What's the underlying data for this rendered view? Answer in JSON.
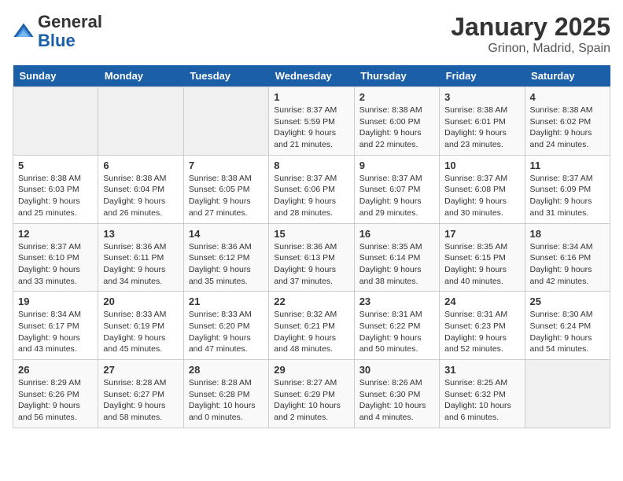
{
  "header": {
    "logo_line1": "General",
    "logo_line2": "Blue",
    "title": "January 2025",
    "subtitle": "Grinon, Madrid, Spain"
  },
  "weekdays": [
    "Sunday",
    "Monday",
    "Tuesday",
    "Wednesday",
    "Thursday",
    "Friday",
    "Saturday"
  ],
  "weeks": [
    [
      {
        "day": "",
        "info": ""
      },
      {
        "day": "",
        "info": ""
      },
      {
        "day": "",
        "info": ""
      },
      {
        "day": "1",
        "info": "Sunrise: 8:37 AM\nSunset: 5:59 PM\nDaylight: 9 hours\nand 21 minutes."
      },
      {
        "day": "2",
        "info": "Sunrise: 8:38 AM\nSunset: 6:00 PM\nDaylight: 9 hours\nand 22 minutes."
      },
      {
        "day": "3",
        "info": "Sunrise: 8:38 AM\nSunset: 6:01 PM\nDaylight: 9 hours\nand 23 minutes."
      },
      {
        "day": "4",
        "info": "Sunrise: 8:38 AM\nSunset: 6:02 PM\nDaylight: 9 hours\nand 24 minutes."
      }
    ],
    [
      {
        "day": "5",
        "info": "Sunrise: 8:38 AM\nSunset: 6:03 PM\nDaylight: 9 hours\nand 25 minutes."
      },
      {
        "day": "6",
        "info": "Sunrise: 8:38 AM\nSunset: 6:04 PM\nDaylight: 9 hours\nand 26 minutes."
      },
      {
        "day": "7",
        "info": "Sunrise: 8:38 AM\nSunset: 6:05 PM\nDaylight: 9 hours\nand 27 minutes."
      },
      {
        "day": "8",
        "info": "Sunrise: 8:37 AM\nSunset: 6:06 PM\nDaylight: 9 hours\nand 28 minutes."
      },
      {
        "day": "9",
        "info": "Sunrise: 8:37 AM\nSunset: 6:07 PM\nDaylight: 9 hours\nand 29 minutes."
      },
      {
        "day": "10",
        "info": "Sunrise: 8:37 AM\nSunset: 6:08 PM\nDaylight: 9 hours\nand 30 minutes."
      },
      {
        "day": "11",
        "info": "Sunrise: 8:37 AM\nSunset: 6:09 PM\nDaylight: 9 hours\nand 31 minutes."
      }
    ],
    [
      {
        "day": "12",
        "info": "Sunrise: 8:37 AM\nSunset: 6:10 PM\nDaylight: 9 hours\nand 33 minutes."
      },
      {
        "day": "13",
        "info": "Sunrise: 8:36 AM\nSunset: 6:11 PM\nDaylight: 9 hours\nand 34 minutes."
      },
      {
        "day": "14",
        "info": "Sunrise: 8:36 AM\nSunset: 6:12 PM\nDaylight: 9 hours\nand 35 minutes."
      },
      {
        "day": "15",
        "info": "Sunrise: 8:36 AM\nSunset: 6:13 PM\nDaylight: 9 hours\nand 37 minutes."
      },
      {
        "day": "16",
        "info": "Sunrise: 8:35 AM\nSunset: 6:14 PM\nDaylight: 9 hours\nand 38 minutes."
      },
      {
        "day": "17",
        "info": "Sunrise: 8:35 AM\nSunset: 6:15 PM\nDaylight: 9 hours\nand 40 minutes."
      },
      {
        "day": "18",
        "info": "Sunrise: 8:34 AM\nSunset: 6:16 PM\nDaylight: 9 hours\nand 42 minutes."
      }
    ],
    [
      {
        "day": "19",
        "info": "Sunrise: 8:34 AM\nSunset: 6:17 PM\nDaylight: 9 hours\nand 43 minutes."
      },
      {
        "day": "20",
        "info": "Sunrise: 8:33 AM\nSunset: 6:19 PM\nDaylight: 9 hours\nand 45 minutes."
      },
      {
        "day": "21",
        "info": "Sunrise: 8:33 AM\nSunset: 6:20 PM\nDaylight: 9 hours\nand 47 minutes."
      },
      {
        "day": "22",
        "info": "Sunrise: 8:32 AM\nSunset: 6:21 PM\nDaylight: 9 hours\nand 48 minutes."
      },
      {
        "day": "23",
        "info": "Sunrise: 8:31 AM\nSunset: 6:22 PM\nDaylight: 9 hours\nand 50 minutes."
      },
      {
        "day": "24",
        "info": "Sunrise: 8:31 AM\nSunset: 6:23 PM\nDaylight: 9 hours\nand 52 minutes."
      },
      {
        "day": "25",
        "info": "Sunrise: 8:30 AM\nSunset: 6:24 PM\nDaylight: 9 hours\nand 54 minutes."
      }
    ],
    [
      {
        "day": "26",
        "info": "Sunrise: 8:29 AM\nSunset: 6:26 PM\nDaylight: 9 hours\nand 56 minutes."
      },
      {
        "day": "27",
        "info": "Sunrise: 8:28 AM\nSunset: 6:27 PM\nDaylight: 9 hours\nand 58 minutes."
      },
      {
        "day": "28",
        "info": "Sunrise: 8:28 AM\nSunset: 6:28 PM\nDaylight: 10 hours\nand 0 minutes."
      },
      {
        "day": "29",
        "info": "Sunrise: 8:27 AM\nSunset: 6:29 PM\nDaylight: 10 hours\nand 2 minutes."
      },
      {
        "day": "30",
        "info": "Sunrise: 8:26 AM\nSunset: 6:30 PM\nDaylight: 10 hours\nand 4 minutes."
      },
      {
        "day": "31",
        "info": "Sunrise: 8:25 AM\nSunset: 6:32 PM\nDaylight: 10 hours\nand 6 minutes."
      },
      {
        "day": "",
        "info": ""
      }
    ]
  ]
}
